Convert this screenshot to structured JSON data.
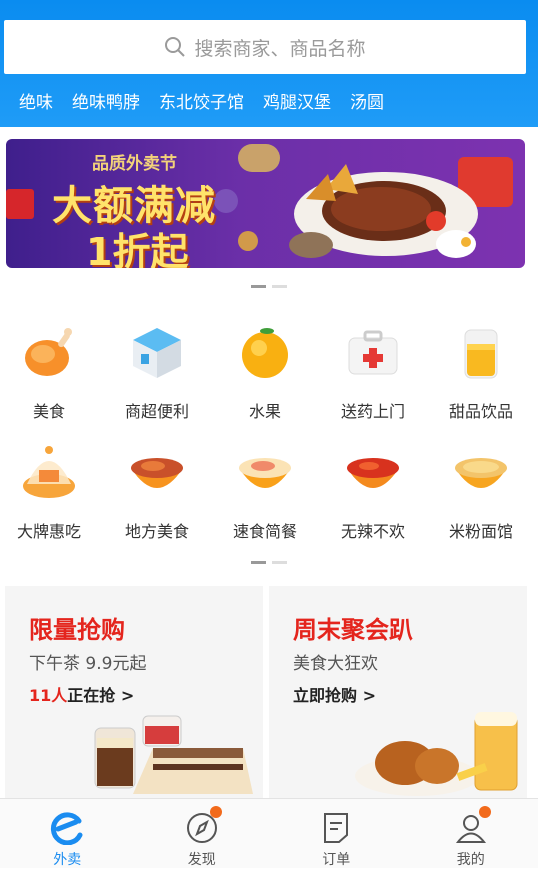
{
  "search": {
    "placeholder": "搜索商家、商品名称"
  },
  "hotwords": [
    "绝味",
    "绝味鸭脖",
    "东北饺子馆",
    "鸡腿汉堡",
    "汤圆"
  ],
  "banner": {
    "subtitle": "品质外卖节",
    "line1": "大额满减",
    "line2": "1折起"
  },
  "categories_row1": [
    {
      "label": "美食",
      "icon": "chicken-icon"
    },
    {
      "label": "商超便利",
      "icon": "store-icon"
    },
    {
      "label": "水果",
      "icon": "orange-icon"
    },
    {
      "label": "送药上门",
      "icon": "medkit-icon"
    },
    {
      "label": "甜品饮品",
      "icon": "juice-icon"
    }
  ],
  "categories_row2": [
    {
      "label": "大牌惠吃",
      "icon": "cake-dome-icon"
    },
    {
      "label": "地方美食",
      "icon": "bowl-icon"
    },
    {
      "label": "速食简餐",
      "icon": "bowl-icon"
    },
    {
      "label": "无辣不欢",
      "icon": "bowl-icon"
    },
    {
      "label": "米粉面馆",
      "icon": "bowl-icon"
    }
  ],
  "promo_left": {
    "title": "限量抢购",
    "subtitle": "下午茶 9.9元起",
    "count": "11人",
    "link": "正在抢 >"
  },
  "promo_right": {
    "title": "周末聚会趴",
    "subtitle": "美食大狂欢",
    "link": "立即抢购 >"
  },
  "tabs": [
    {
      "label": "外卖",
      "icon": "eleme-icon"
    },
    {
      "label": "发现",
      "icon": "compass-icon"
    },
    {
      "label": "订单",
      "icon": "order-icon"
    },
    {
      "label": "我的",
      "icon": "user-icon"
    }
  ],
  "colors": {
    "header": "#0a8cf0",
    "accent": "#1a8cf0",
    "promo_red": "#e4251d",
    "badge": "#f26a1b"
  }
}
